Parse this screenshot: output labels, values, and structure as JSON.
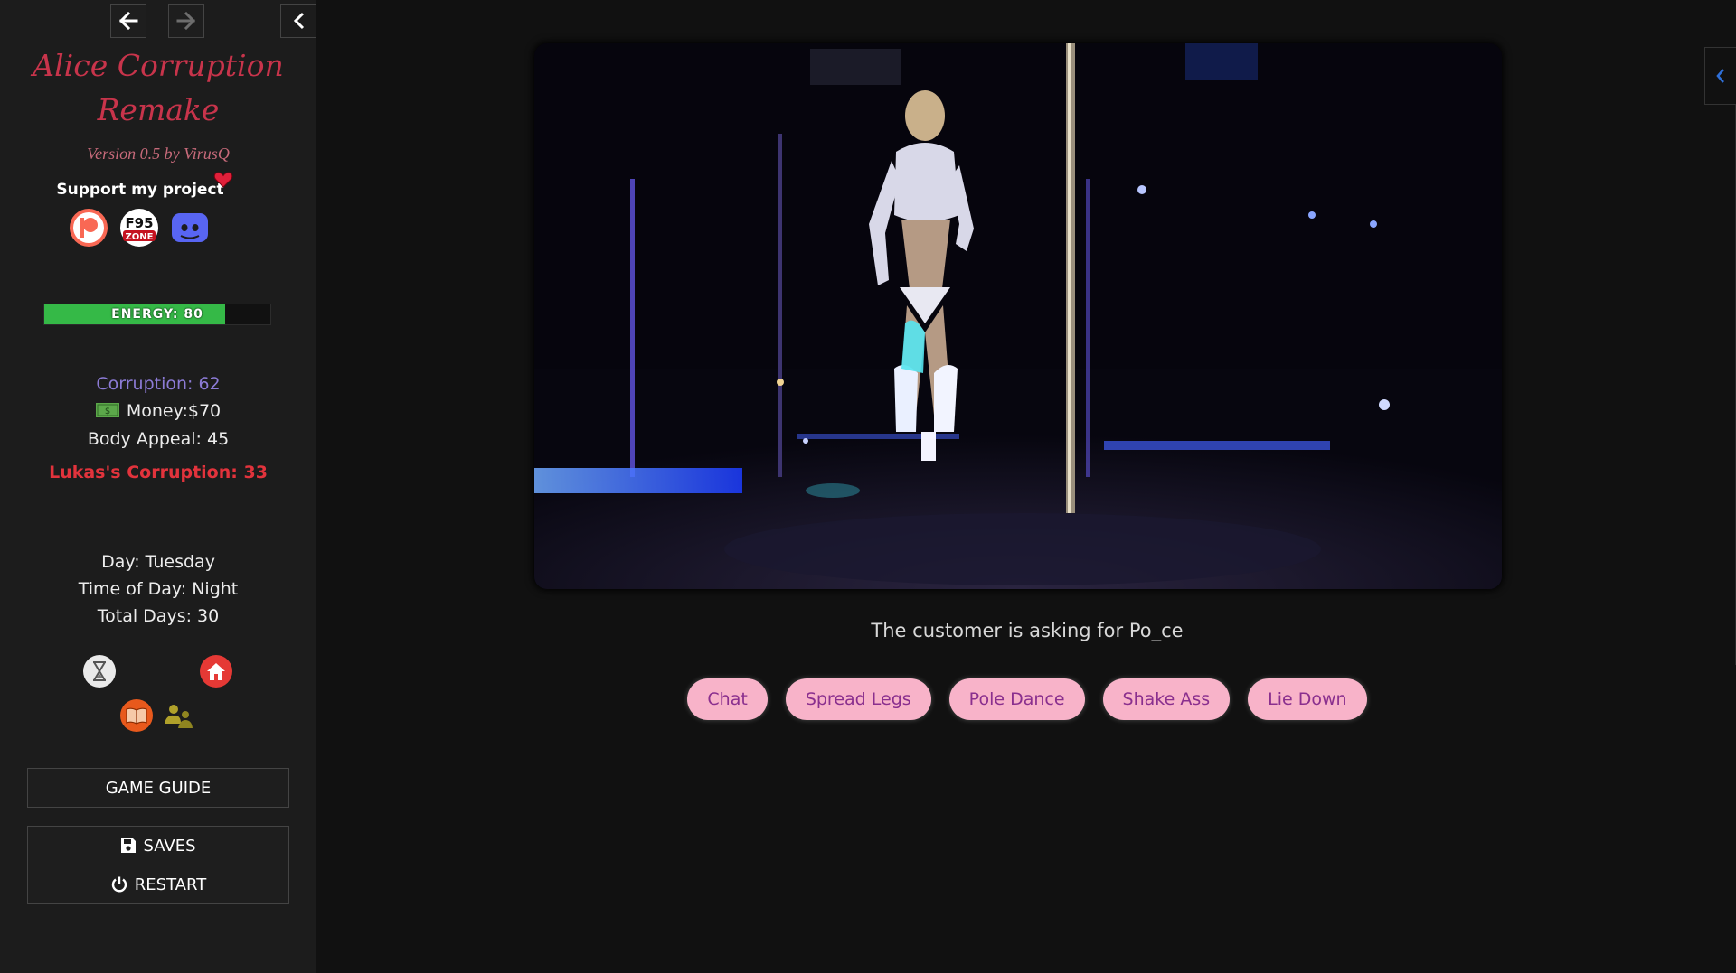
{
  "sidebar": {
    "title_line1": "Alice Corruption",
    "title_line2": "Remake",
    "version": "Version 0.5 by VirusQ",
    "support": "Support my project",
    "social": {
      "patreon_icon": "patreon-icon",
      "f95_icon": "f95zone-icon",
      "discord_icon": "discord-icon"
    },
    "energy": {
      "label": "ENERGY: 80",
      "percent": 80
    },
    "stats": {
      "corruption": "Corruption: 62",
      "money": "Money:$70",
      "body_appeal": "Body Appeal: 45",
      "lukas_corruption": "Lukas's Corruption: 33",
      "day": "Day: Tuesday",
      "time_of_day": "Time of Day: Night",
      "total_days": "Total Days: 30"
    },
    "buttons": {
      "game_guide": "GAME GUIDE",
      "saves": "SAVES",
      "restart": "RESTART"
    }
  },
  "passage": {
    "prompt": "The customer is asking for Po_ce",
    "choices": [
      "Chat",
      "Spread Legs",
      "Pole Dance",
      "Shake Ass",
      "Lie Down"
    ]
  },
  "colors": {
    "title": "#c8344b",
    "corruption": "#8c7bd6",
    "lukas": "#e2333c",
    "energy": "#35b947",
    "choice_bg": "#f8b3c9",
    "choice_text": "#8a2f8e",
    "accent_blue": "#2f6fd8"
  }
}
